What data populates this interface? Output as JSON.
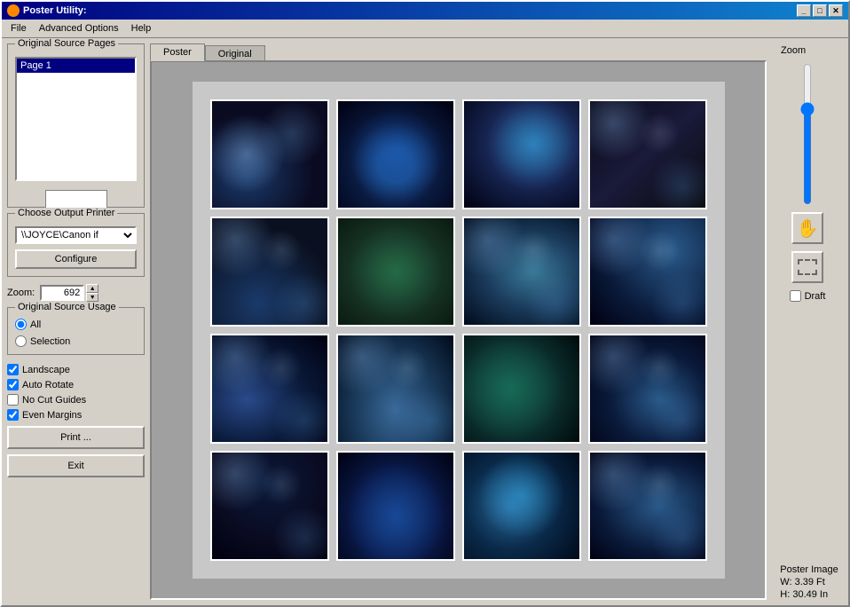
{
  "window": {
    "title": "Poster Utility:",
    "icon": "poster-icon"
  },
  "titleControls": {
    "minimize": "_",
    "maximize": "□",
    "close": "✕"
  },
  "menuBar": {
    "items": [
      {
        "id": "file",
        "label": "File"
      },
      {
        "id": "advanced-options",
        "label": "Advanced Options"
      },
      {
        "id": "help",
        "label": "Help"
      }
    ]
  },
  "leftPanel": {
    "sourcePages": {
      "title": "Original Source Pages",
      "pages": [
        "Page 1"
      ]
    },
    "outputPrinter": {
      "title": "Choose Output Printer",
      "selected": "\\\\JOYCE\\Canon if",
      "options": [
        "\\\\JOYCE\\Canon if"
      ]
    },
    "configureButton": "Configure",
    "zoom": {
      "label": "Zoom:",
      "value": "692"
    },
    "sourceUsage": {
      "title": "Original Source Usage",
      "options": [
        {
          "id": "all",
          "label": "All",
          "checked": true
        },
        {
          "id": "selection",
          "label": "Selection",
          "checked": false
        }
      ]
    },
    "checkboxes": [
      {
        "id": "landscape",
        "label": "Landscape",
        "checked": true
      },
      {
        "id": "auto-rotate",
        "label": "Auto Rotate",
        "checked": true
      },
      {
        "id": "no-cut-guides",
        "label": "No Cut Guides",
        "checked": false
      },
      {
        "id": "even-margins",
        "label": "Even Margins",
        "checked": true
      }
    ],
    "printButton": "Print ...",
    "exitButton": "Exit"
  },
  "tabs": [
    {
      "id": "poster",
      "label": "Poster",
      "active": true
    },
    {
      "id": "original",
      "label": "Original",
      "active": false
    }
  ],
  "poster": {
    "grid": {
      "rows": 4,
      "cols": 4,
      "cells": [
        {
          "id": 1,
          "class": "cell-1"
        },
        {
          "id": 2,
          "class": "cell-2"
        },
        {
          "id": 3,
          "class": "cell-3"
        },
        {
          "id": 4,
          "class": "cell-4"
        },
        {
          "id": 5,
          "class": "cell-5"
        },
        {
          "id": 6,
          "class": "cell-6"
        },
        {
          "id": 7,
          "class": "cell-7"
        },
        {
          "id": 8,
          "class": "cell-8"
        },
        {
          "id": 9,
          "class": "cell-9"
        },
        {
          "id": 10,
          "class": "cell-10"
        },
        {
          "id": 11,
          "class": "cell-11"
        },
        {
          "id": 12,
          "class": "cell-12"
        },
        {
          "id": 13,
          "class": "cell-13"
        },
        {
          "id": 14,
          "class": "cell-14"
        },
        {
          "id": 15,
          "class": "cell-15"
        },
        {
          "id": 16,
          "class": "cell-16"
        }
      ]
    }
  },
  "rightPanel": {
    "zoomLabel": "Zoom",
    "tools": [
      {
        "id": "pan",
        "icon": "✋",
        "label": "pan-tool"
      },
      {
        "id": "select",
        "icon": "⬚",
        "label": "select-tool"
      }
    ],
    "draft": {
      "label": "Draft",
      "checked": false
    },
    "posterImage": {
      "label": "Poster Image",
      "width": "W: 3.39 Ft",
      "height": "H: 30.49 In"
    }
  }
}
